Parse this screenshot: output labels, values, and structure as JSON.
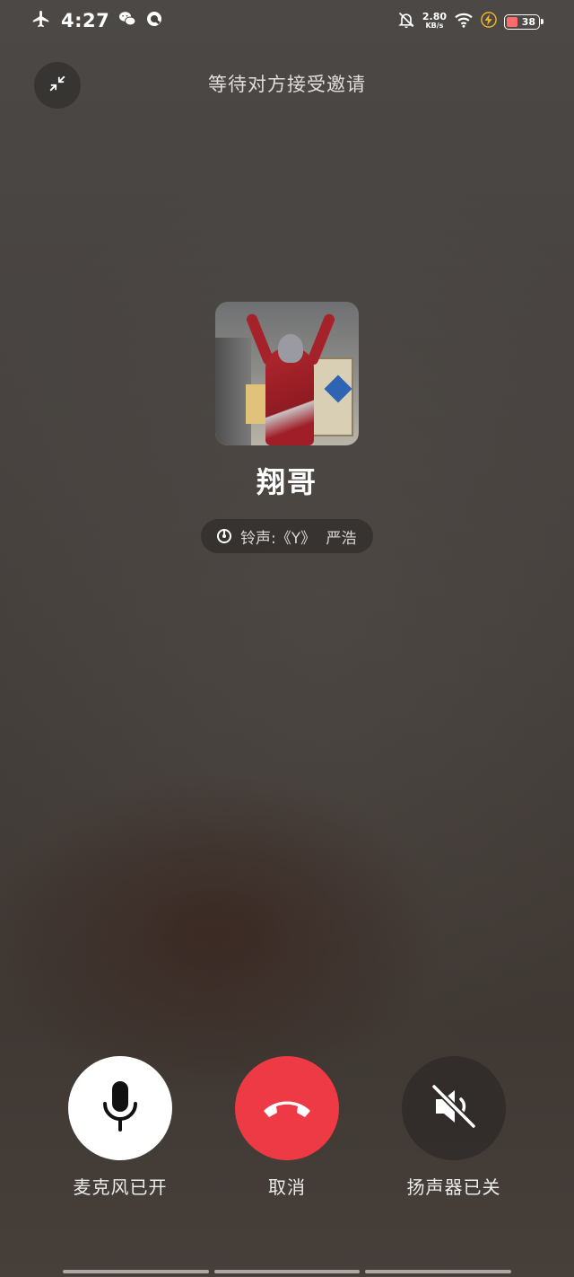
{
  "status_bar": {
    "time": "4:27",
    "net_speed_value": "2.80",
    "net_speed_unit": "KB/s",
    "battery_level": "38",
    "icons": [
      "airplane-mode-icon",
      "wechat-icon",
      "q-app-icon",
      "mute-bell-icon",
      "wifi-icon",
      "charging-icon",
      "battery-icon"
    ]
  },
  "header": {
    "title": "等待对方接受邀请",
    "minimize_icon": "minimize-icon"
  },
  "callee": {
    "name": "翔哥",
    "ringtone_text": "铃声:《Y》 严浩"
  },
  "controls": {
    "mic_label": "麦克风已开",
    "cancel_label": "取消",
    "speaker_label": "扬声器已关",
    "colors": {
      "mic_bg": "#ffffff",
      "cancel_bg": "#ee3a44",
      "speaker_bg": "#2d2a28"
    }
  }
}
